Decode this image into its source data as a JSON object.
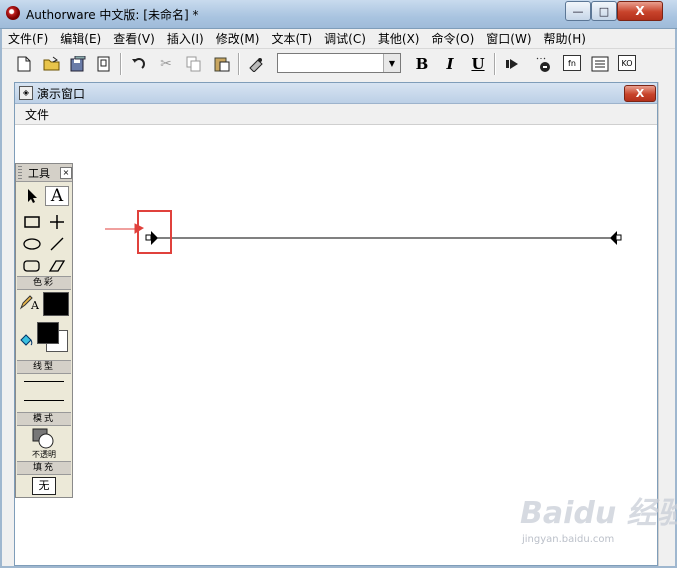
{
  "window": {
    "title": "Authorware 中文版: [未命名] *",
    "close_label": "X",
    "min_label": "—",
    "max_label": "□"
  },
  "menubar": [
    "文件(F)",
    "编辑(E)",
    "查看(V)",
    "插入(I)",
    "修改(M)",
    "文本(T)",
    "调试(C)",
    "其他(X)",
    "命令(O)",
    "窗口(W)",
    "帮助(H)"
  ],
  "toolbar": {
    "font_value": "",
    "bold_label": "B",
    "italic_label": "I",
    "underline_label": "U",
    "fn_label": "fn",
    "ko_label": "KO"
  },
  "presentation": {
    "title": "演示窗口",
    "close_label": "X",
    "menu_file": "文件"
  },
  "palette": {
    "title": "工具",
    "text_tool": "A",
    "color_section": "色彩",
    "line_section": "线型",
    "mode_section": "模式",
    "mode_value": "不透明",
    "fill_section": "填充",
    "fill_value": "无",
    "pen_text_label": "A"
  },
  "watermark": {
    "brand": "Baidu 经验",
    "site": "jingyan.baidu.com"
  },
  "colors": {
    "annotation_red": "#e0413c",
    "title_gradient": "#a9c4e0",
    "close_red": "#c8432b"
  }
}
